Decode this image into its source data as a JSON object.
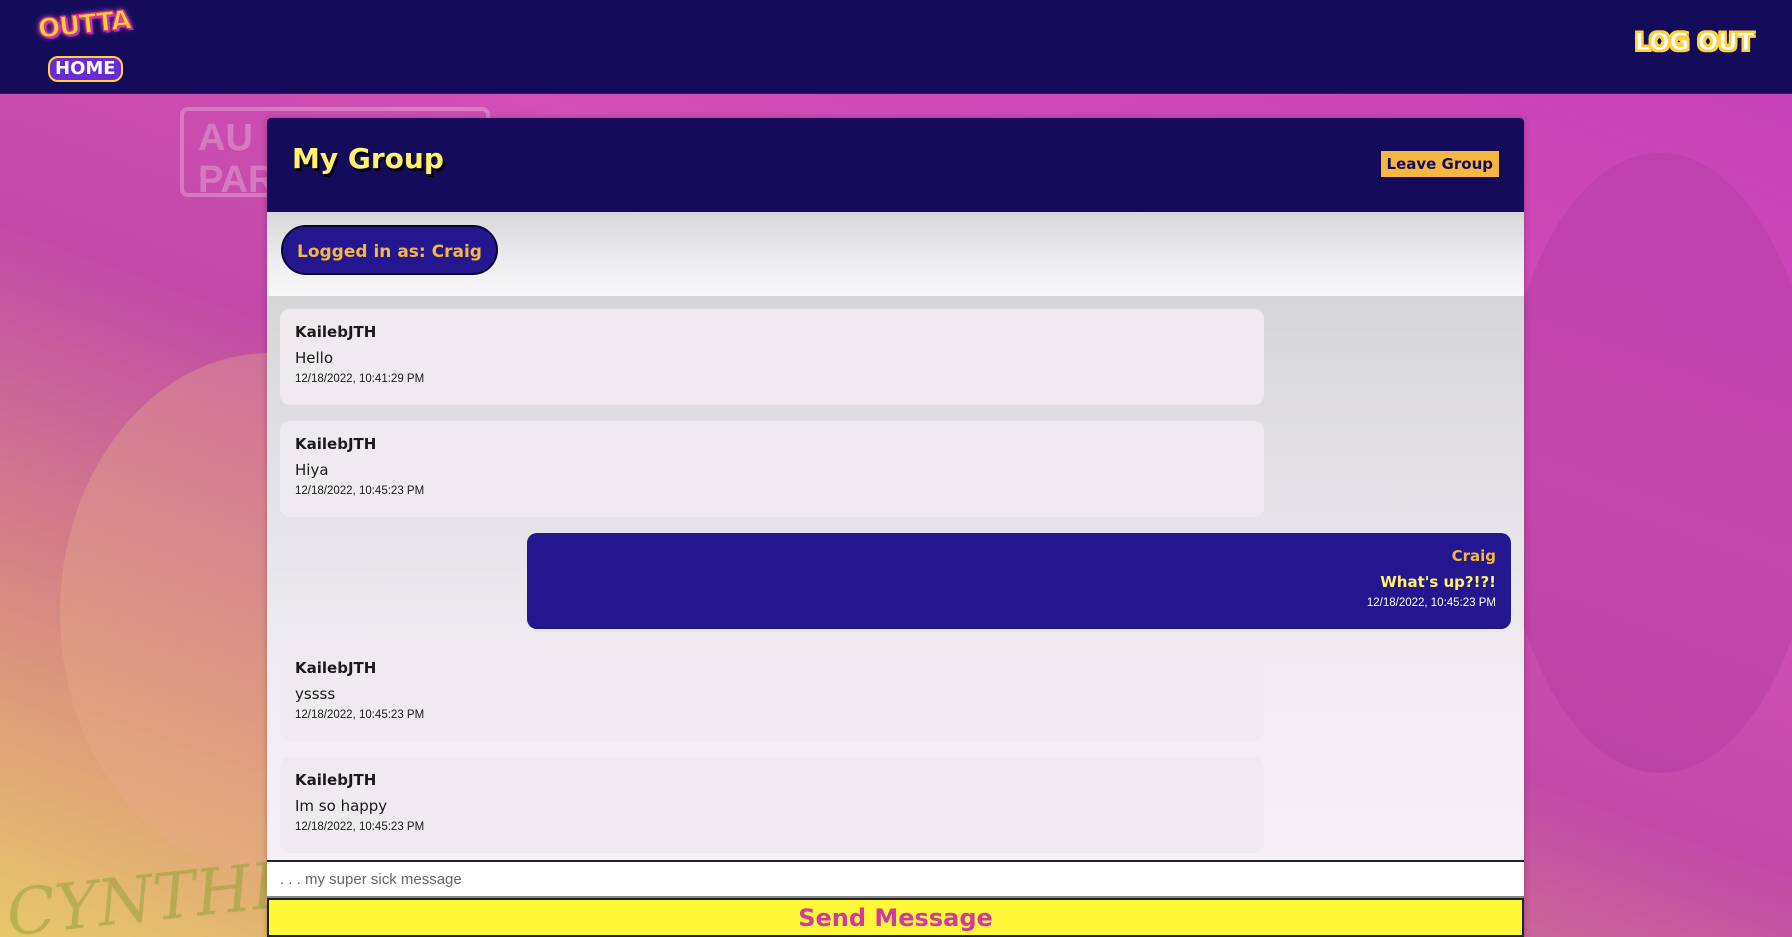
{
  "nav": {
    "logo_top": "OUTTA",
    "logo_bottom": "HOME",
    "logout_label": "LOG OUT"
  },
  "background": {
    "sign_text_line1": "AU",
    "sign_text_line2": "PAR",
    "scrawl_text": "CYNTHIA"
  },
  "chat": {
    "title": "My Group",
    "leave_label": "Leave Group",
    "logged_in_label": "Logged in as: Craig",
    "messages": [
      {
        "author": "KailebJTH",
        "text": "Hello",
        "time": "12/18/2022, 10:41:29 PM",
        "mine": false
      },
      {
        "author": "KailebJTH",
        "text": "Hiya",
        "time": "12/18/2022, 10:45:23 PM",
        "mine": false
      },
      {
        "author": "Craig",
        "text": "What's up?!?!",
        "time": "12/18/2022, 10:45:23 PM",
        "mine": true
      },
      {
        "author": "KailebJTH",
        "text": "yssss",
        "time": "12/18/2022, 10:45:23 PM",
        "mine": false
      },
      {
        "author": "KailebJTH",
        "text": "Im so happy",
        "time": "12/18/2022, 10:45:23 PM",
        "mine": false
      }
    ],
    "input_placeholder": ". . . my super sick message",
    "input_value": "",
    "send_label": "Send Message"
  },
  "colors": {
    "nav_bg": "#140c5a",
    "accent_yellow": "#fff36a",
    "accent_orange": "#f6b740",
    "own_bubble": "#24168f",
    "send_bg": "#fff836",
    "send_text": "#d03aa3"
  }
}
